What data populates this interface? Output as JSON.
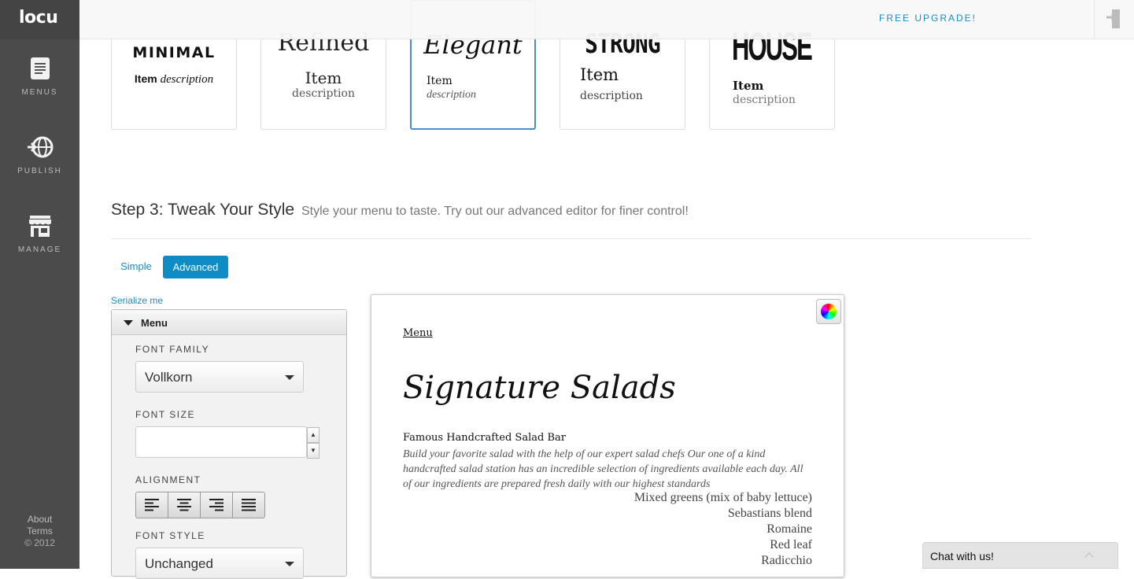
{
  "app": {
    "logo": "locu"
  },
  "sidebar": {
    "items": [
      {
        "label": "MENUS",
        "icon": "document-icon"
      },
      {
        "label": "PUBLISH",
        "icon": "globe-arrow-icon"
      },
      {
        "label": "MANAGE",
        "icon": "storefront-icon"
      }
    ],
    "footer": {
      "about": "About",
      "terms": "Terms",
      "copyright": "© 2012"
    }
  },
  "topbar": {
    "upgrade": "FREE UPGRADE!",
    "logout_icon": "logout-icon"
  },
  "styles": [
    {
      "title": "MINIMAL",
      "item": "Item",
      "desc": "description"
    },
    {
      "title": "Refined",
      "item": "Item",
      "desc": "description"
    },
    {
      "title": "Elegant",
      "item": "Item",
      "desc": "description",
      "selected": true
    },
    {
      "title": "STRONG",
      "item": "Item",
      "desc": "description"
    },
    {
      "title": "HOUSE",
      "item": "Item",
      "desc": "description"
    }
  ],
  "step3": {
    "title": "Step 3: Tweak Your Style",
    "subtitle": "Style your menu to taste. Try out our advanced editor for finer control!",
    "tabs": {
      "simple": "Simple",
      "advanced": "Advanced"
    },
    "serialize": "Serialize me"
  },
  "panel": {
    "header": "Menu",
    "font_family_label": "FONT FAMILY",
    "font_family_value": "Vollkorn",
    "font_size_label": "FONT SIZE",
    "font_size_value": "",
    "alignment_label": "ALIGNMENT",
    "font_style_label": "FONT STYLE",
    "font_style_value": "Unchanged"
  },
  "preview": {
    "menu_title": "Menu",
    "section_title": "Signature Salads",
    "item_name": "Famous Handcrafted Salad Bar",
    "item_desc": "Build your favorite salad with the help of our expert salad chefs Our one of a kind handcrafted salad station has an incredible selection of ingredients available each day. All of our ingredients are prepared fresh daily with our highest standards",
    "options": [
      "Mixed greens (mix of baby lettuce)",
      "Sebastians blend",
      "Romaine",
      "Red leaf",
      "Radicchio"
    ]
  },
  "chat": {
    "label": "Chat with us!"
  },
  "colors": {
    "accent": "#0e8cc4",
    "sidebar": "#4b4b4b",
    "selected_border": "#4a8cd0"
  }
}
